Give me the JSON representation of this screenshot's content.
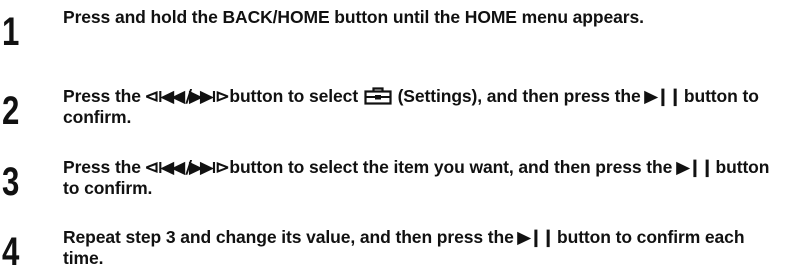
{
  "steps": [
    {
      "number": "1",
      "text": "Press and hold the BACK/HOME button until the HOME menu appears."
    },
    {
      "number": "2",
      "part1": "Press the ",
      "prev_next_icon": "⧏◀◀ /▶▶⧐",
      "part2": " button to select ",
      "settings_icon_name": "settings-toolbox-icon",
      "part3": " (Settings), and then press the ",
      "play_pause_icon": "▶❙❙",
      "part4": " button to confirm."
    },
    {
      "number": "3",
      "part1": "Press the ",
      "prev_next_icon": "⧏◀◀ /▶▶⧐",
      "part2": " button to select the item you want, and then press the ",
      "play_pause_icon": "▶❙❙",
      "part3": " button to confirm."
    },
    {
      "number": "4",
      "part1": "Repeat step 3 and change its value, and then press the ",
      "play_pause_icon": "▶❙❙",
      "part2": " button to confirm each time."
    }
  ]
}
